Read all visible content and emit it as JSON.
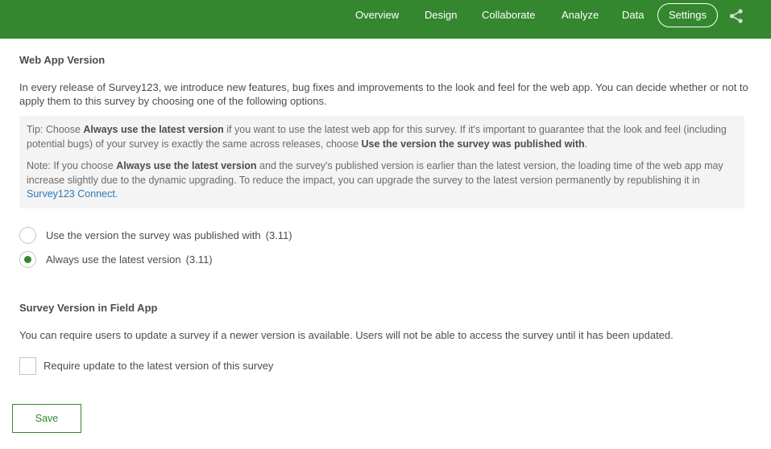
{
  "nav": {
    "items": [
      {
        "label": "Overview"
      },
      {
        "label": "Design"
      },
      {
        "label": "Collaborate"
      },
      {
        "label": "Analyze"
      },
      {
        "label": "Data"
      },
      {
        "label": "Settings",
        "active": true
      }
    ],
    "share_icon": "share-icon"
  },
  "web_app": {
    "heading": "Web App Version",
    "description": "In every release of Survey123, we introduce new features, bug fixes and improvements to the look and feel for the web app. You can decide whether or not to apply them to this survey by choosing one of the following options.",
    "tip": {
      "prefix": "Tip: Choose ",
      "bold1": "Always use the latest version",
      "middle": " if you want to use the latest web app for this survey. If it's important to guarantee that the look and feel (including potential bugs) of your survey is exactly the same across releases, choose ",
      "bold2": "Use the version the survey was published with",
      "suffix": "."
    },
    "note": {
      "prefix": "Note: If you choose ",
      "bold": "Always use the latest version",
      "text": " and the survey's published version is earlier than the latest version, the loading time of the web app may increase slightly due to the dynamic upgrading. To reduce the impact, you can upgrade the survey to the latest version permanently by republishing it in ",
      "link": "Survey123 Connect",
      "suffix": "."
    },
    "options": [
      {
        "label": "Use the version the survey was published with",
        "version": "(3.11)",
        "checked": false
      },
      {
        "label": "Always use the latest version",
        "version": "(3.11)",
        "checked": true
      }
    ]
  },
  "field_app": {
    "heading": "Survey Version in Field App",
    "description": "You can require users to update a survey if a newer version is available. Users will not be able to access the survey until it has been updated.",
    "checkbox_label": "Require update to the latest version of this survey",
    "checked": false
  },
  "save_label": "Save",
  "colors": {
    "brand_green": "#35872f",
    "link_blue": "#2e78b8",
    "tip_background": "#f4f4f4"
  }
}
